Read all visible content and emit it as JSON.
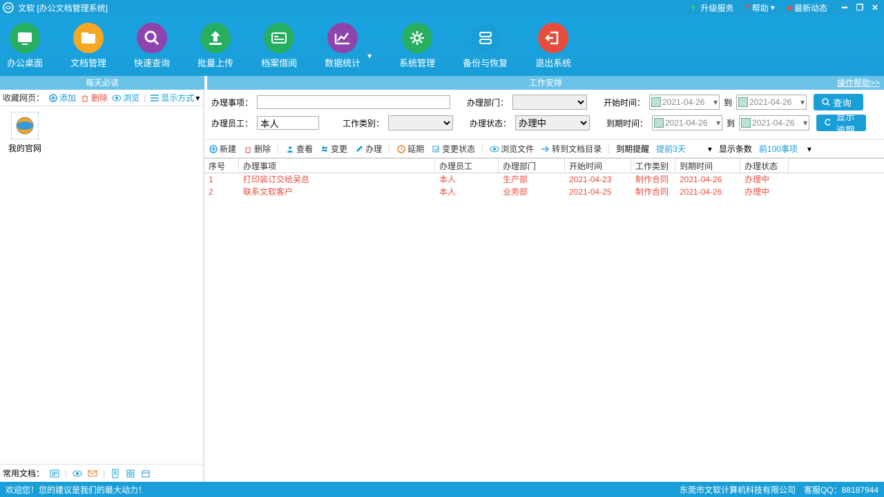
{
  "titlebar": {
    "app_title": "文软 [办公文档管理系统]",
    "upgrade": "升级服务",
    "help": "帮助",
    "news": "最新动态"
  },
  "ribbon": [
    {
      "label": "办公桌面",
      "color": "#27AE60",
      "icon": "desktop"
    },
    {
      "label": "文档管理",
      "color": "#F5A623",
      "icon": "folder"
    },
    {
      "label": "快速查询",
      "color": "#8E44AD",
      "icon": "search"
    },
    {
      "label": "批量上传",
      "color": "#27AE60",
      "icon": "upload"
    },
    {
      "label": "档案借阅",
      "color": "#27AE60",
      "icon": "card"
    },
    {
      "label": "数据统计",
      "color": "#8E44AD",
      "icon": "chart"
    },
    {
      "label": "系统管理",
      "color": "#27AE60",
      "icon": "gear"
    },
    {
      "label": "备份与恢复",
      "color": "#199ED8",
      "icon": "backup"
    },
    {
      "label": "退出系统",
      "color": "#E84C3D",
      "icon": "exit"
    }
  ],
  "section_headers": {
    "left": "每天必读",
    "right": "工作安排",
    "help_link": "操作帮助>>"
  },
  "left": {
    "fav_label": "收藏网页：",
    "add": "添加",
    "delete": "删除",
    "browse": "浏览",
    "display_mode": "显示方式",
    "desktop_icon": "我的官网",
    "common_docs": "常用文档："
  },
  "filters": {
    "task_label": "办理事项：",
    "emp_label": "办理员工：",
    "emp_value": "本人",
    "cat_label": "工作类别：",
    "dept_label": "办理部门：",
    "status_label": "办理状态：",
    "status_value": "办理中",
    "start_label": "开始时间：",
    "due_label": "到期时间：",
    "to": "到",
    "date": "2021-04-26",
    "query_btn": "查询",
    "overdue_btn": "显示逾期"
  },
  "actions": {
    "new": "新建",
    "delete": "删除",
    "view": "查看",
    "change": "变更",
    "process": "办理",
    "extend": "延期",
    "change_status": "变更状态",
    "browse_file": "浏览文件",
    "goto_dir": "转到文档目录",
    "due_remind": "到期提醒",
    "remind3": "提前3天",
    "show_rows": "显示条数",
    "top100": "前100事项"
  },
  "table": {
    "headers": {
      "seq": "序号",
      "task": "办理事项",
      "emp": "办理员工",
      "dept": "办理部门",
      "start": "开始时间",
      "cat": "工作类别",
      "due": "到期时间",
      "stat": "办理状态"
    },
    "rows": [
      {
        "seq": "1",
        "task": "打印装订交给吴总",
        "emp": "本人",
        "dept": "生产部",
        "start": "2021-04-23",
        "cat": "制作合同",
        "due": "2021-04-26",
        "stat": "办理中"
      },
      {
        "seq": "2",
        "task": "联系文软客户",
        "emp": "本人",
        "dept": "业务部",
        "start": "2021-04-25",
        "cat": "制作合同",
        "due": "2021-04-26",
        "stat": "办理中"
      }
    ]
  },
  "statusbar": {
    "welcome": "欢迎您！您的建议是我们的最大动力！",
    "company": "东莞市文软计算机科技有限公司　客服QQ：88187944"
  }
}
